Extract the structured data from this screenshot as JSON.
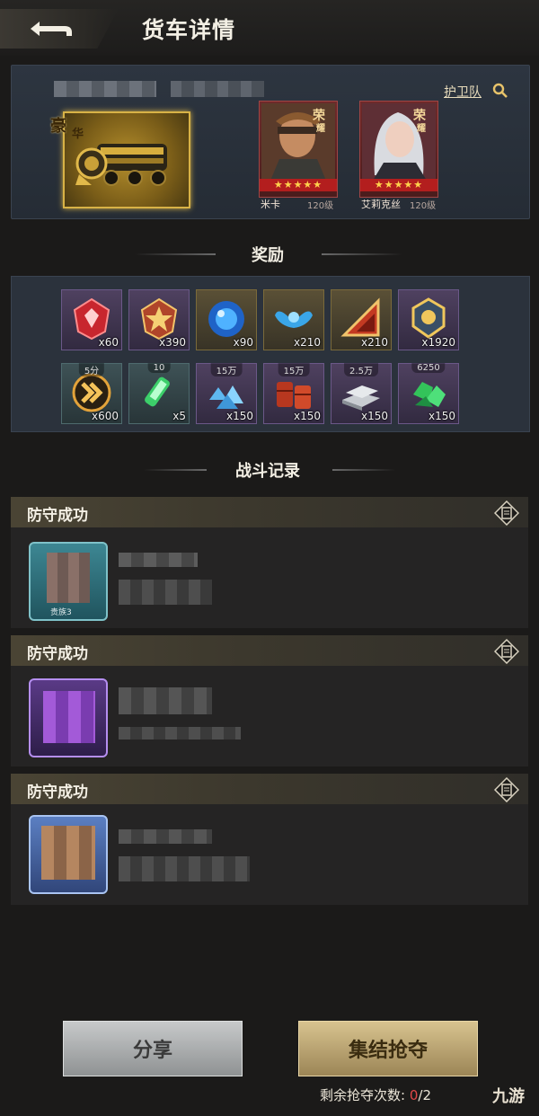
{
  "header": {
    "title": "货车详情",
    "back_label": "back"
  },
  "truck": {
    "rank_text": "豪",
    "rank_text2": "华",
    "escort_label": "护卫队",
    "heroes": [
      {
        "badge": "荣",
        "badge2": "耀",
        "name": "米卡",
        "level": "120级",
        "stars": "★★★★★"
      },
      {
        "badge": "荣",
        "badge2": "耀",
        "name": "艾莉克丝",
        "level": "120级",
        "stars": "★★★★★"
      }
    ]
  },
  "rewards": {
    "title": "奖励",
    "items": [
      {
        "icon": "red-rank-badge-icon",
        "qty": "x60",
        "cap": ""
      },
      {
        "icon": "gold-rank-badge-icon",
        "qty": "x390",
        "cap": ""
      },
      {
        "icon": "blue-orb-icon",
        "qty": "x90",
        "cap": ""
      },
      {
        "icon": "blue-wings-icon",
        "qty": "x210",
        "cap": ""
      },
      {
        "icon": "red-triangle-icon",
        "qty": "x210",
        "cap": ""
      },
      {
        "icon": "gold-emblem-icon",
        "qty": "x1920",
        "cap": ""
      },
      {
        "icon": "speedup-chevron-icon",
        "qty": "x600",
        "cap": "5分"
      },
      {
        "icon": "green-syringe-icon",
        "qty": "x5",
        "cap": "10"
      },
      {
        "icon": "blue-crystal-icon",
        "qty": "x150",
        "cap": "15万"
      },
      {
        "icon": "oil-barrel-icon",
        "qty": "x150",
        "cap": "15万"
      },
      {
        "icon": "steel-ingot-icon",
        "qty": "x150",
        "cap": "2.5万"
      },
      {
        "icon": "green-gem-icon",
        "qty": "x150",
        "cap": "6250"
      }
    ]
  },
  "battle": {
    "title": "战斗记录",
    "records": [
      {
        "result": "防守成功",
        "avatar_tag": "贵族3"
      },
      {
        "result": "防守成功",
        "avatar_tag": ""
      },
      {
        "result": "防守成功",
        "avatar_tag": ""
      }
    ]
  },
  "footer": {
    "share_label": "分享",
    "rally_label": "集结抢夺",
    "remaining_label": "剩余抢夺次数:",
    "remaining_used": "0",
    "remaining_total": "/2",
    "logo": "九游"
  }
}
